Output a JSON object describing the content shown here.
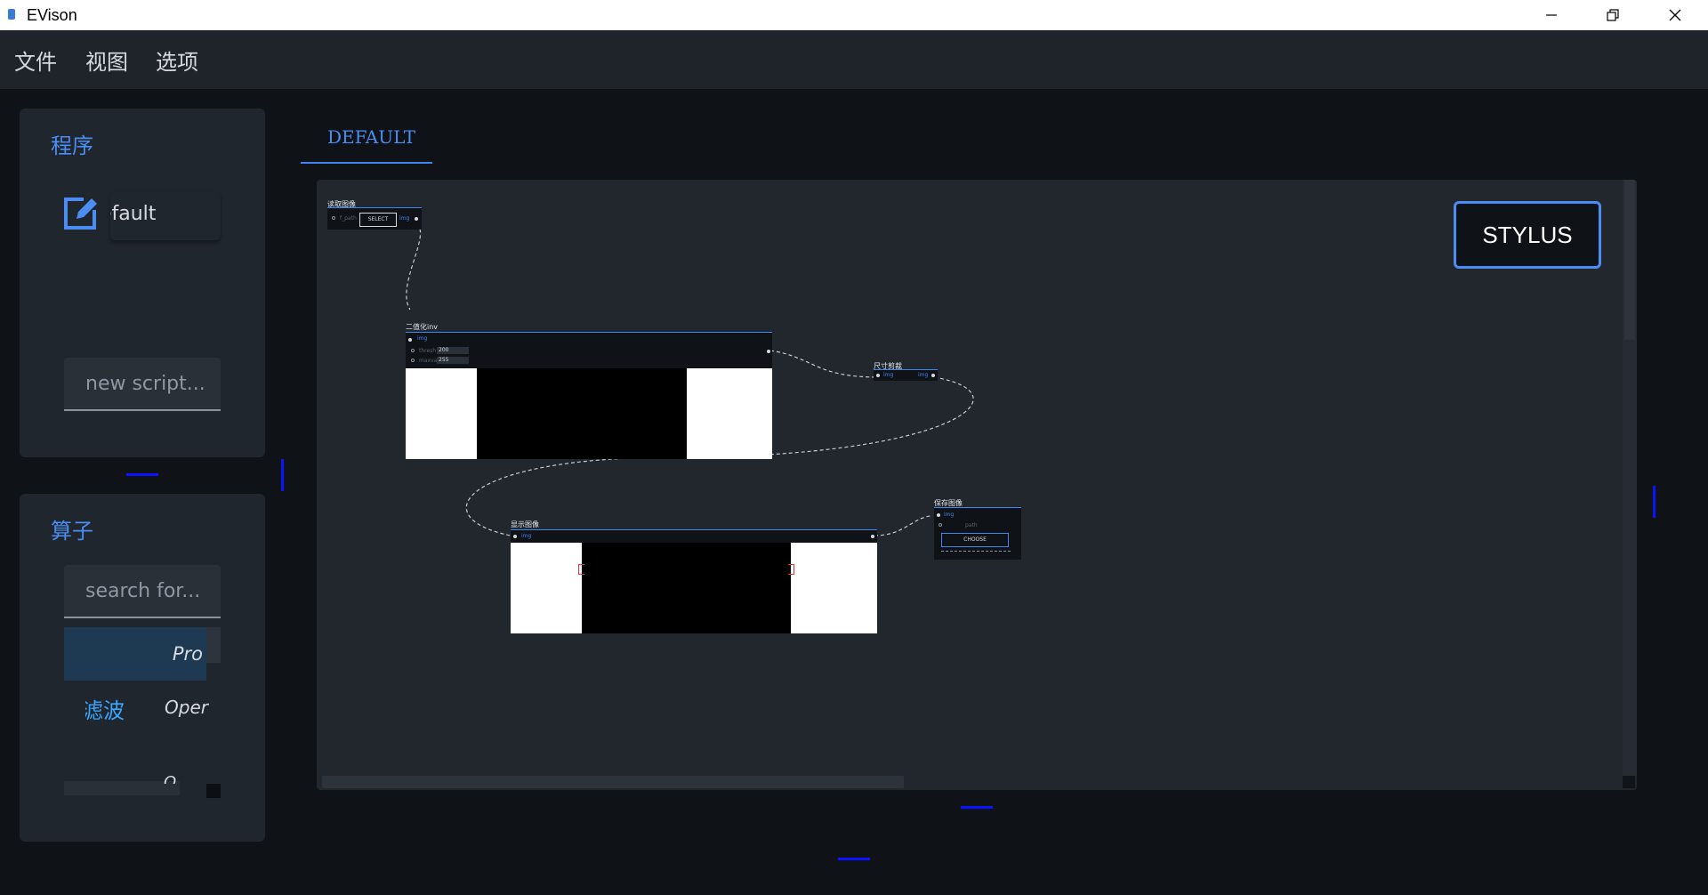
{
  "window": {
    "title": "EVison"
  },
  "menu": {
    "items": [
      "文件",
      "视图",
      "选项"
    ]
  },
  "program_panel": {
    "title": "程序",
    "script_name": "default",
    "new_script_placeholder": "new script..."
  },
  "operator_panel": {
    "title": "算子",
    "search_placeholder": "search for...",
    "selected_item": "Pro",
    "row_cn": "滤波",
    "row_en": "Oper",
    "row3_letter": "O"
  },
  "tabs": [
    "DEFAULT"
  ],
  "canvas": {
    "stylus_label": "STYLUS",
    "nodes": {
      "read_image": {
        "title": "读取图像",
        "param": "f_path",
        "button": "SELECT",
        "out_port": "img"
      },
      "binarize": {
        "title": "二值化inv",
        "in_port": "img",
        "params": [
          {
            "label": "thresh",
            "value": "200"
          },
          {
            "label": "maxval",
            "value": "255"
          }
        ]
      },
      "resize": {
        "title": "尺寸剪裁",
        "in_port": "img",
        "out_port": "img"
      },
      "show_image": {
        "title": "显示图像",
        "in_port": "img"
      },
      "save_image": {
        "title": "保存图像",
        "in_port": "img",
        "param": "path",
        "button": "CHOOSE"
      }
    }
  },
  "colors": {
    "accent": "#4b8df2",
    "background": "#0f1318",
    "panel": "#20262d",
    "canvas": "#22272e"
  }
}
